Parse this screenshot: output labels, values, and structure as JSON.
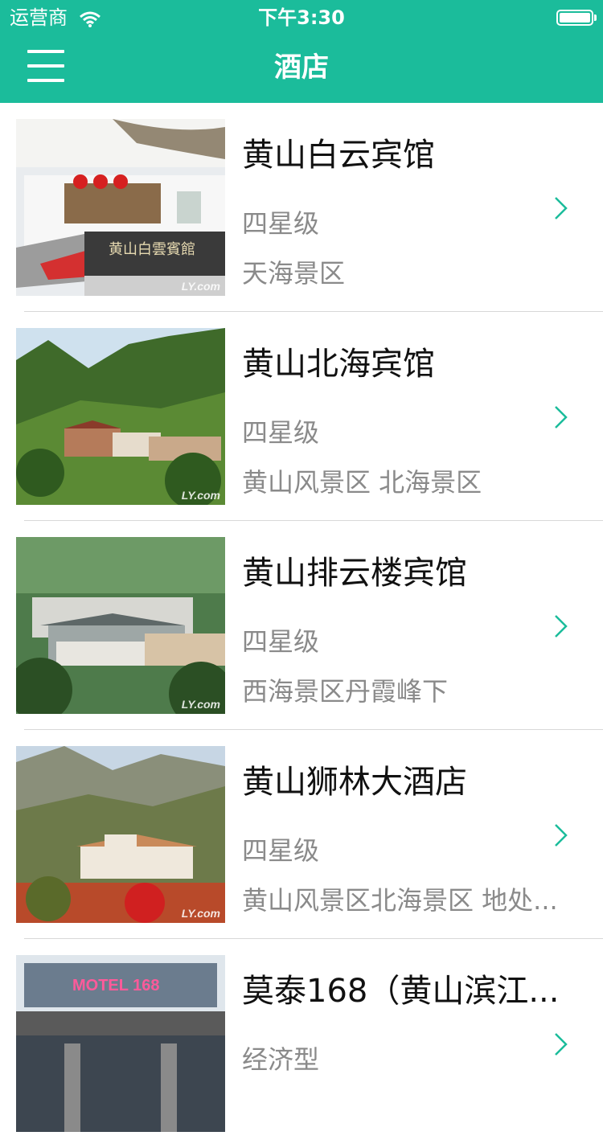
{
  "status": {
    "carrier": "运营商",
    "time": "下午3:30",
    "battery_level": 1.0
  },
  "nav": {
    "title": "酒店"
  },
  "theme": {
    "accent": "#1bbc9b"
  },
  "hotels": [
    {
      "name": "黄山白云宾馆",
      "grade": "四星级",
      "area": "天海景区"
    },
    {
      "name": "黄山北海宾馆",
      "grade": "四星级",
      "area": "黄山风景区 北海景区"
    },
    {
      "name": "黄山排云楼宾馆",
      "grade": "四星级",
      "area": "西海景区丹霞峰下"
    },
    {
      "name": "黄山狮林大酒店",
      "grade": "四星级",
      "area": "黄山风景区北海景区 地处..."
    },
    {
      "name": "莫泰168（黄山滨江...",
      "grade": "经济型",
      "area": ""
    }
  ],
  "image_text": {
    "sign1": "黄山白雲賓館",
    "watermark": "LY.com",
    "motel": "MOTEL 168"
  }
}
